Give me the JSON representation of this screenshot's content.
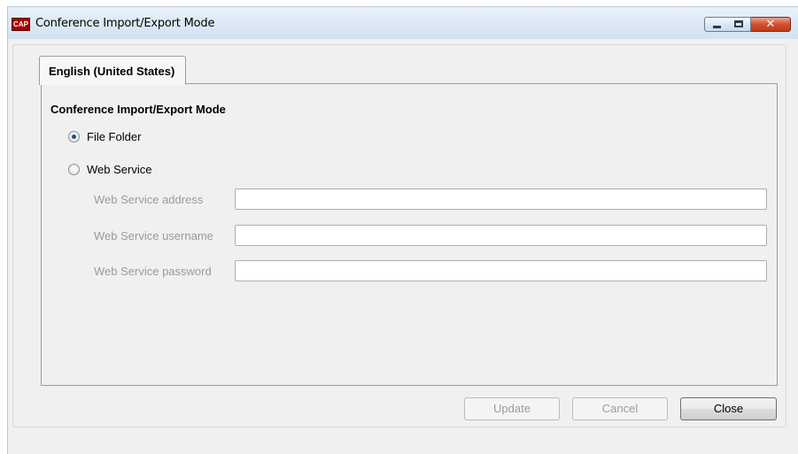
{
  "window": {
    "title": "Conference Import/Export Mode",
    "app_icon_text": "CAP",
    "controls": {
      "minimize_icon": "minimize-icon",
      "maximize_icon": "maximize-icon",
      "close_glyph": "✕"
    }
  },
  "tabs": [
    {
      "label": "English (United States)",
      "selected": true
    }
  ],
  "section": {
    "title": "Conference Import/Export Mode"
  },
  "mode_options": [
    {
      "label": "File Folder",
      "checked": true
    },
    {
      "label": "Web Service",
      "checked": false
    }
  ],
  "web_service": {
    "address_label": "Web Service address",
    "address_value": "",
    "username_label": "Web Service username",
    "username_value": "",
    "password_label": "Web Service password",
    "password_value": ""
  },
  "buttons": {
    "update": "Update",
    "cancel": "Cancel",
    "close": "Close"
  },
  "colors": {
    "title_bar": "#dbe7f5",
    "close_button": "#d2502f",
    "disabled_text": "#9a9a9a",
    "radio_dot": "#1c5180"
  }
}
